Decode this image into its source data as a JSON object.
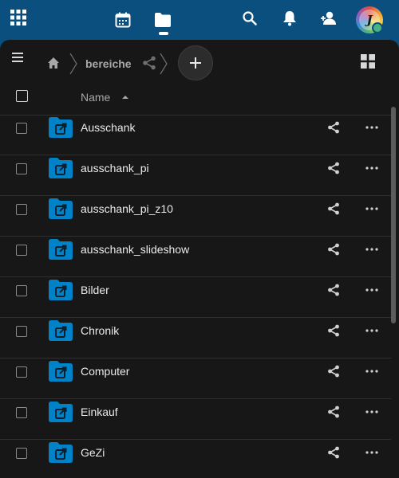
{
  "topbar": {
    "apps_menu_icon": "apps-grid-icon",
    "apps": [
      {
        "name": "calendar",
        "icon": "calendar-icon",
        "active": false
      },
      {
        "name": "files",
        "icon": "folder-icon",
        "active": true
      }
    ],
    "actions": [
      "search-icon",
      "bell-icon",
      "contacts-icon"
    ],
    "avatar_initial": "J",
    "status": "online"
  },
  "breadcrumb": {
    "home_icon": "home-icon",
    "current_folder": "bereiche",
    "shared_icon": "share-icon"
  },
  "toolbar": {
    "new_button_icon": "plus-icon",
    "view_toggle_icon": "grid-view-icon"
  },
  "table": {
    "name_header": "Name",
    "sort": "ascending",
    "files": [
      {
        "name": "Ausschank"
      },
      {
        "name": "ausschank_pi"
      },
      {
        "name": "ausschank_pi_z10"
      },
      {
        "name": "ausschank_slideshow"
      },
      {
        "name": "Bilder"
      },
      {
        "name": "Chronik"
      },
      {
        "name": "Computer"
      },
      {
        "name": "Einkauf"
      },
      {
        "name": "GeZi"
      }
    ]
  },
  "colors": {
    "header_bg": "#0b4f7e",
    "panel_bg": "#171717",
    "folder_blue": "#0082c9",
    "text": "#ebebeb",
    "muted": "#a8a8a8"
  }
}
